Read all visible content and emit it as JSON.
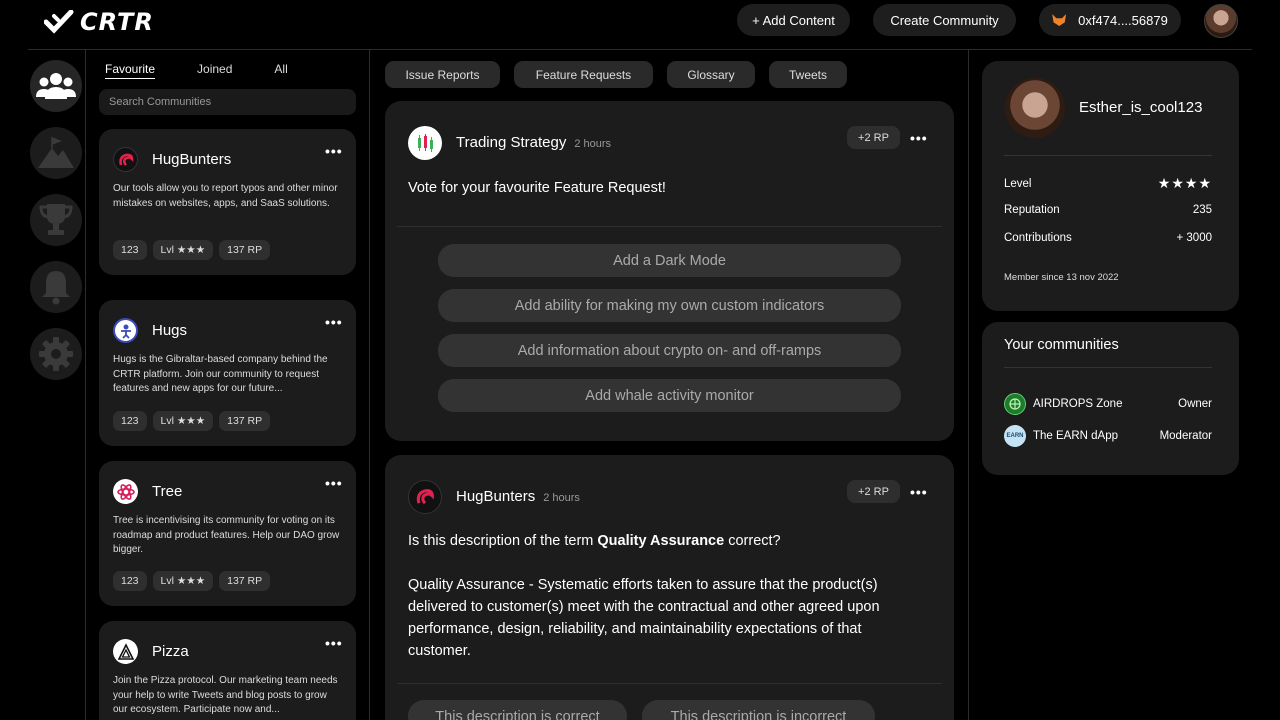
{
  "header": {
    "logo_text": "CRTR",
    "add_content": "+ Add Content",
    "create_community": "Create Community",
    "wallet": "0xf474....56879",
    "wallet_icon": "fox-icon"
  },
  "rail": [
    {
      "icon": "community-icon"
    },
    {
      "icon": "mountain-flag-icon"
    },
    {
      "icon": "trophy-icon"
    },
    {
      "icon": "bell-icon"
    },
    {
      "icon": "gear-icon"
    }
  ],
  "communities": {
    "tabs": [
      "Favourite",
      "Joined",
      "All"
    ],
    "search_placeholder": "Search Communities",
    "items": [
      {
        "name": "HugBunters",
        "desc": "Our tools allow you to report typos and other minor mistakes on websites, apps, and SaaS solutions.",
        "count": "123",
        "level": "Lvl ★★★",
        "rp": "137 RP"
      },
      {
        "name": "Hugs",
        "desc": "Hugs is the Gibraltar-based company behind the CRTR platform. Join our community to request features and new apps for our future...",
        "count": "123",
        "level": "Lvl ★★★",
        "rp": "137 RP"
      },
      {
        "name": "Tree",
        "desc": "Tree is incentivising its community for voting on its roadmap and product features. Help our DAO grow bigger.",
        "count": "123",
        "level": "Lvl ★★★",
        "rp": "137 RP"
      },
      {
        "name": "Pizza",
        "desc": "Join the Pizza protocol. Our marketing team needs your help to write Tweets and blog posts to grow our ecosystem. Participate now and..."
      }
    ]
  },
  "filters": [
    "Issue Reports",
    "Feature Requests",
    "Glossary",
    "Tweets"
  ],
  "posts": [
    {
      "author": "Trading Strategy",
      "time": "2 hours",
      "rp": "+2 RP",
      "question": "Vote for your favourite Feature Request!",
      "options": [
        "Add a Dark Mode",
        "Add ability for making my own custom indicators",
        "Add information about crypto on- and off-ramps",
        "Add whale activity monitor"
      ]
    },
    {
      "author": "HugBunters",
      "time": "2 hours",
      "rp": "+2 RP",
      "question_pre": "Is this description of the term ",
      "question_term": "Quality Assurance",
      "question_post": " correct?",
      "body": "Quality Assurance - Systematic efforts taken to assure that the product(s) delivered to customer(s) meet with the contractual and other agreed upon performance, design, reliability, and maintainability expectations of that customer.",
      "options": [
        "This description is correct",
        "This description is incorrect"
      ]
    }
  ],
  "profile": {
    "username": "Esther_is_cool123",
    "level_label": "Level",
    "level_stars": "★★★★",
    "reputation_label": "Reputation",
    "reputation": "235",
    "contributions_label": "Contributions",
    "contributions": "+ 3000",
    "member_since": "Member since 13 nov 2022"
  },
  "your_communities": {
    "title": "Your communities",
    "items": [
      {
        "name": "AIRDROPS Zone",
        "role": "Owner"
      },
      {
        "name": "The EARN dApp",
        "role": "Moderator"
      }
    ]
  },
  "colors": {
    "bg": "#000000",
    "card": "#1c1c1c",
    "accent_red": "#e0224e",
    "green": "#3fae5a"
  }
}
